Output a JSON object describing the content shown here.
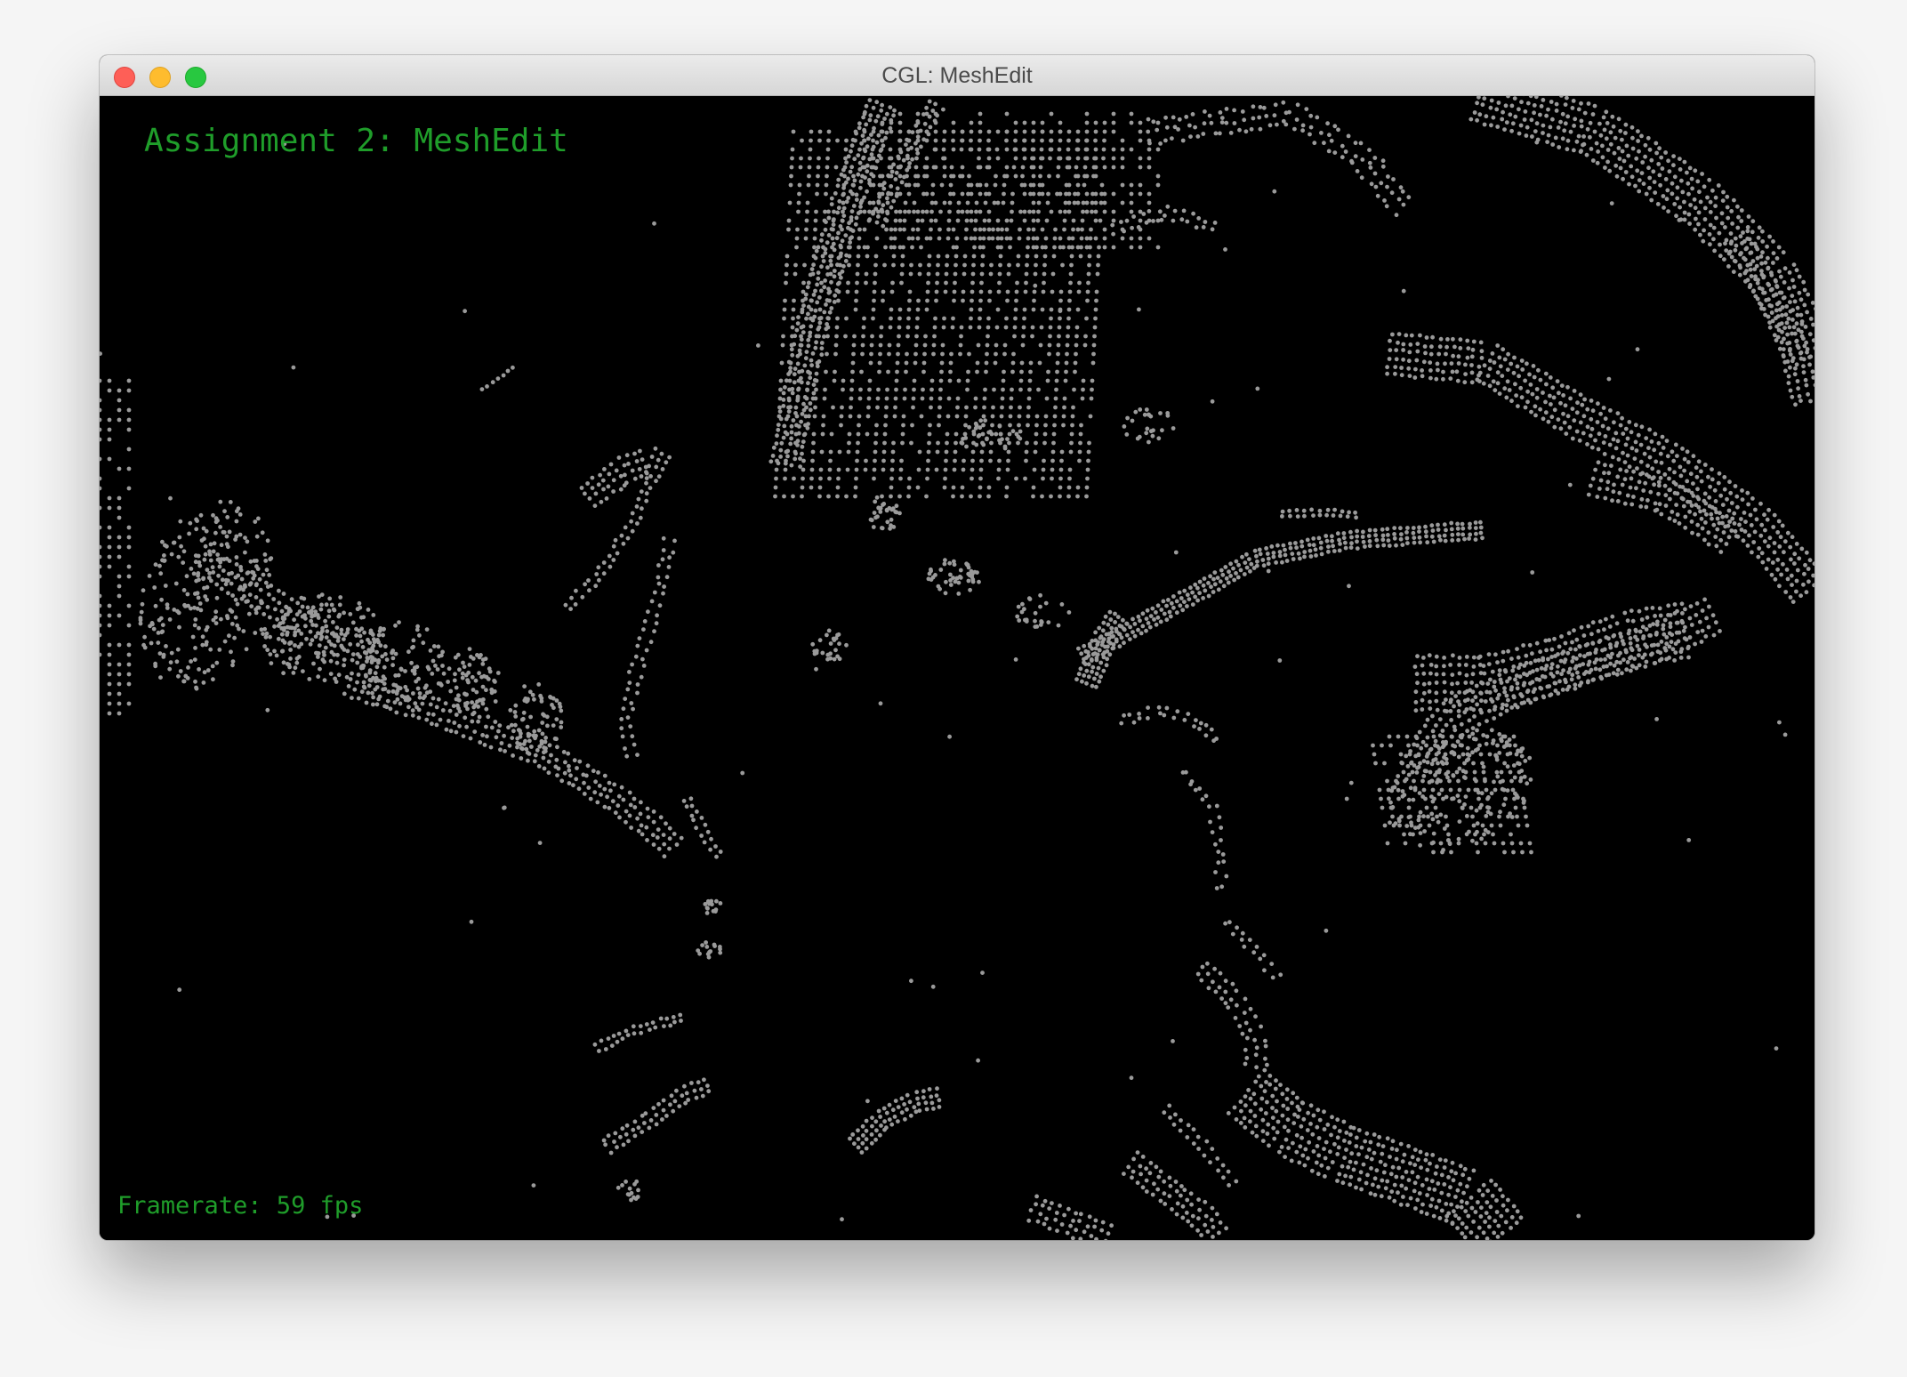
{
  "window": {
    "title": "CGL: MeshEdit"
  },
  "overlay": {
    "assignment_title": "Assignment 2: MeshEdit",
    "framerate_label": "Framerate: 59 fps"
  },
  "colors": {
    "background": "#000000",
    "points": "#9a9a9a",
    "overlay_text": "#1f9d2a",
    "titlebar": "#e3e3e3"
  },
  "icons": {
    "close": "close-traffic-light-icon",
    "minimize": "minimize-traffic-light-icon",
    "zoom": "zoom-traffic-light-icon"
  }
}
